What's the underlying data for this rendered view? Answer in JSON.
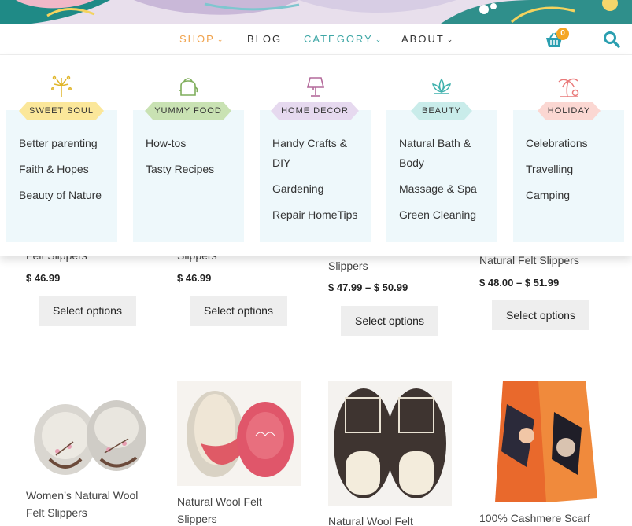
{
  "nav": {
    "items": [
      {
        "label": "SHOP",
        "color": "#f0a24b",
        "has_dropdown": true
      },
      {
        "label": "BLOG",
        "color": "#333333",
        "has_dropdown": false
      },
      {
        "label": "CATEGORY",
        "color": "#3fa7a6",
        "has_dropdown": true
      },
      {
        "label": "ABOUT",
        "color": "#333333",
        "has_dropdown": true
      }
    ],
    "cart_count": "0",
    "cart_icon": "basket-icon",
    "search_icon": "search-icon"
  },
  "mega_menu": {
    "columns": [
      {
        "title": "SWEET SOUL",
        "icon": "fireworks-icon",
        "ribbon_color": "#fbe79a",
        "links": [
          "Better parenting",
          "Faith & Hopes",
          "Beauty of Nature"
        ]
      },
      {
        "title": "YUMMY FOOD",
        "icon": "kettle-icon",
        "ribbon_color": "#c9e2b3",
        "links": [
          "How-tos",
          "Tasty Recipes"
        ]
      },
      {
        "title": "HOME DECOR",
        "icon": "lamp-icon",
        "ribbon_color": "#e6d9ef",
        "links": [
          "Handy Crafts &",
          "DIY",
          "Gardening",
          "Repair HomeTips"
        ]
      },
      {
        "title": "BEAUTY",
        "icon": "lotus-icon",
        "ribbon_color": "#c9ecea",
        "links": [
          "Natural Bath &",
          "Body",
          "Massage & Spa",
          "Green Cleaning"
        ]
      },
      {
        "title": "HOLIDAY",
        "icon": "palm-tree-icon",
        "ribbon_color": "#fbd7d2",
        "links": [
          "Celebrations",
          "Travelling",
          "Camping"
        ]
      }
    ]
  },
  "products_row1": [
    {
      "name": "Felt Slippers",
      "price": "$ 46.99",
      "button": "Select options"
    },
    {
      "name": "Slippers",
      "price": "$ 46.99",
      "button": "Select options"
    },
    {
      "name": "Slippers",
      "price": "$ 47.99 – $ 50.99",
      "button": "Select options"
    },
    {
      "name": "Natural Felt Slippers",
      "price": "$ 48.00 – $ 51.99",
      "button": "Select options"
    }
  ],
  "products_row2": [
    {
      "name_line1": "Women’s Natural Wool",
      "name_line2": "Felt Slippers"
    },
    {
      "name_line1": "Natural Wool Felt",
      "name_line2": "Slippers"
    },
    {
      "name_line1": "Natural Wool Felt",
      "name_line2": ""
    },
    {
      "name_line1": "100% Cashmere Scarf",
      "name_line2": ""
    }
  ]
}
